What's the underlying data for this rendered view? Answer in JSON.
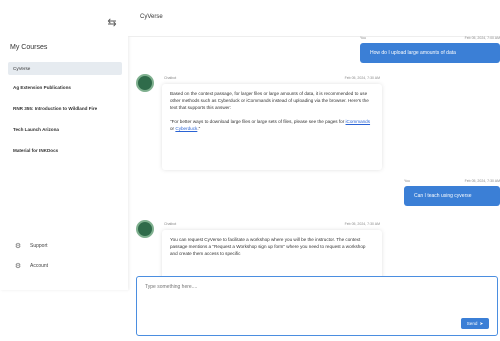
{
  "sidebar": {
    "title": "My Courses",
    "courses": [
      {
        "label": "CyVerse"
      },
      {
        "label": "Ag Extension Publications"
      },
      {
        "label": "RNR 355: Introduction to Wildland Fire"
      },
      {
        "label": "Tech Launch Arizona"
      },
      {
        "label": "Material for INKDocs"
      }
    ],
    "footer": {
      "support": "Support",
      "account": "Account"
    }
  },
  "chat": {
    "title": "CyVerse",
    "messages": [
      {
        "role": "user",
        "sender": "You",
        "time": "Feb 05, 2024, 7:00 AM",
        "text": "How do I upload large amounts of data"
      },
      {
        "role": "assistant",
        "sender": "Chatbot",
        "time": "Feb 05, 2024, 7:30 AM",
        "p1": "Based on the context passage, for larger files or large amounts of data, it is recommended to use other methods such as Cyberduck or iCommands instead of uploading via the browser. Here's the text that supports this answer:",
        "p2_before": "\"For better ways to download large files or large sets of files, please see the pages for ",
        "link1": "iCommands",
        "p2_mid": " or ",
        "link2": "Cyberduck",
        "p2_after": ".\""
      },
      {
        "role": "user",
        "sender": "You",
        "time": "Feb 05, 2024, 7:30 AM",
        "text": "Can I teach using cyverse"
      },
      {
        "role": "assistant",
        "sender": "Chatbot",
        "time": "Feb 05, 2024, 7:30 AM",
        "text": "You can request CyVerse to facilitate a workshop where you will be the instructor. The context passage mentions a \"Request a Workshop sign up form\" where you need to request a workshop and create them access to specific"
      }
    ]
  },
  "composer": {
    "placeholder": "Type something here....",
    "send_label": "Send"
  }
}
